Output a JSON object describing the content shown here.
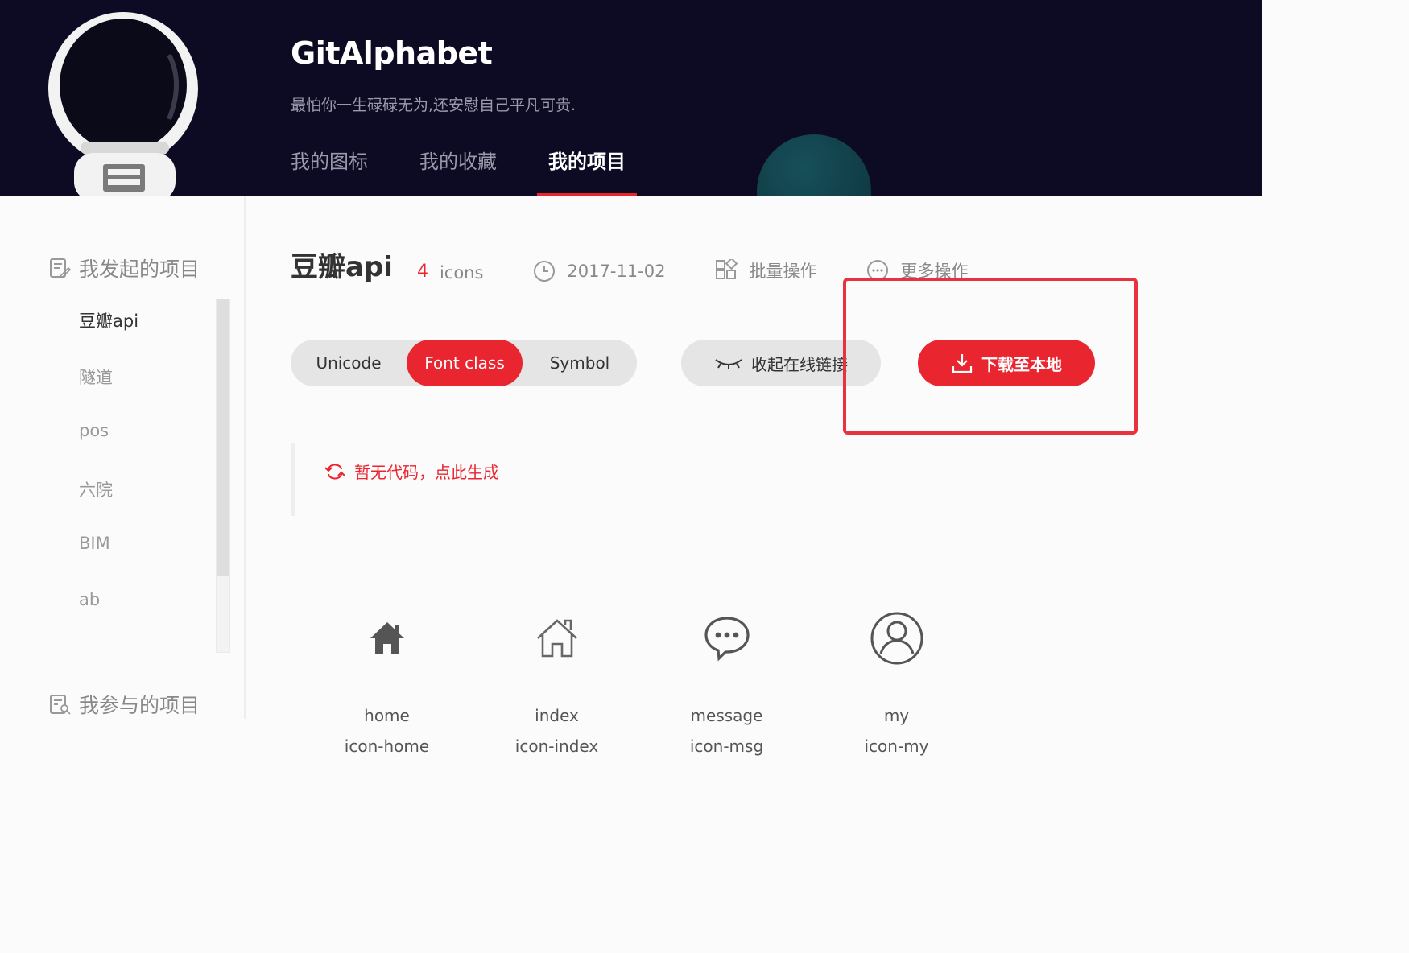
{
  "header": {
    "brand": "GitAlphabet",
    "motto": "最怕你一生碌碌无为,还安慰自己平凡可贵.",
    "tabs": [
      {
        "label": "我的图标"
      },
      {
        "label": "我的收藏"
      },
      {
        "label": "我的项目"
      }
    ],
    "active_tab": "我的项目"
  },
  "sidebar": {
    "started_heading": "我发起的项目",
    "items": [
      {
        "label": "豆瓣api"
      },
      {
        "label": "隧道"
      },
      {
        "label": "pos"
      },
      {
        "label": "六院"
      },
      {
        "label": "BIM"
      },
      {
        "label": "ab"
      }
    ],
    "active_item": "豆瓣api",
    "joined_heading": "我参与的项目"
  },
  "project": {
    "name": "豆瓣api",
    "icon_count": "4",
    "icon_unit": "icons",
    "date": "2017-11-02",
    "batch_label": "批量操作",
    "more_label": "更多操作"
  },
  "modes": {
    "unicode": "Unicode",
    "font_class": "Font class",
    "symbol": "Symbol",
    "active": "Font class"
  },
  "actions": {
    "collapse_label": "收起在线链接",
    "download_label": "下载至本地"
  },
  "code": {
    "generate_label": "暂无代码，点此生成"
  },
  "icons": [
    {
      "name": "home",
      "class": "icon-home",
      "glyph": "home-filled-icon"
    },
    {
      "name": "index",
      "class": "icon-index",
      "glyph": "house-outline-icon"
    },
    {
      "name": "message",
      "class": "icon-msg",
      "glyph": "chat-bubble-icon"
    },
    {
      "name": "my",
      "class": "icon-my",
      "glyph": "user-circle-icon"
    }
  ],
  "colors": {
    "accent": "#e9252f",
    "header_bg": "#0d0b24",
    "highlight_border": "#e8323d"
  }
}
